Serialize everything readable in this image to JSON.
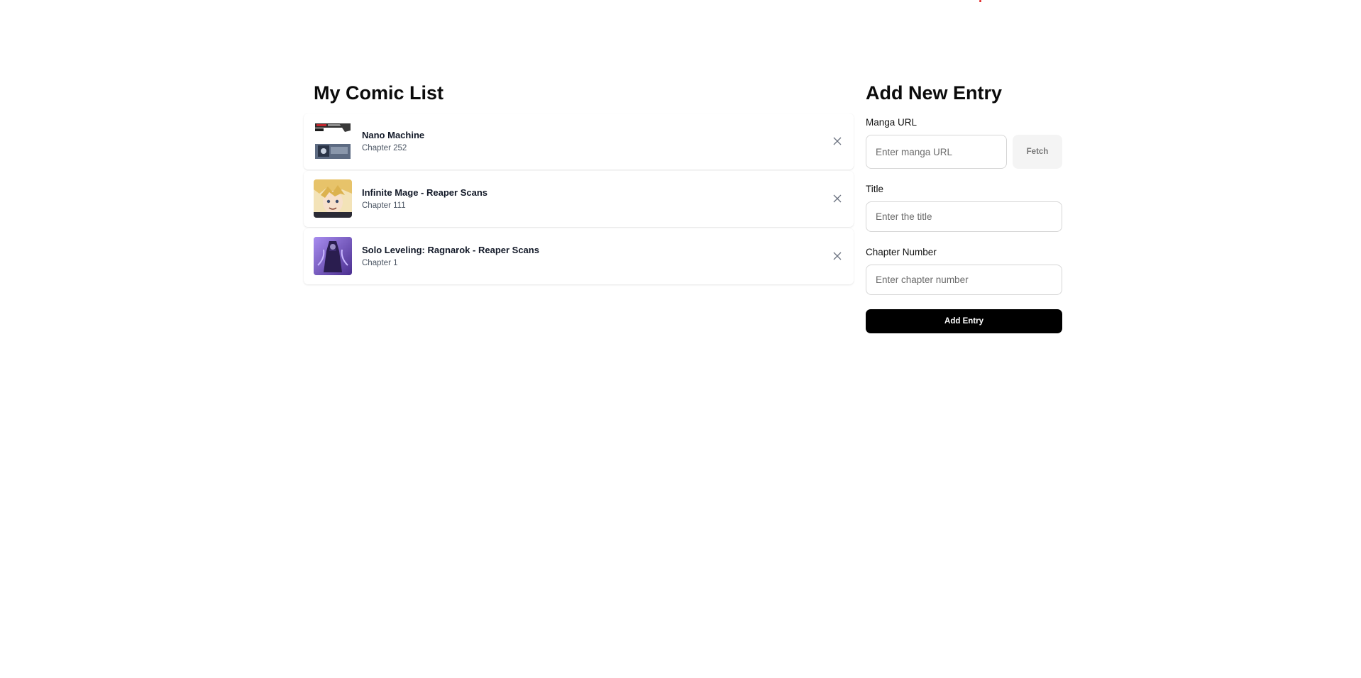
{
  "comic_list": {
    "title": "My Comic List",
    "entries": [
      {
        "title": "Nano Machine",
        "chapter": "Chapter 252",
        "thumb": "nano-machine-cover"
      },
      {
        "title": "Infinite Mage - Reaper Scans",
        "chapter": "Chapter 111",
        "thumb": "infinite-mage-cover"
      },
      {
        "title": "Solo Leveling: Ragnarok - Reaper Scans",
        "chapter": "Chapter 1",
        "thumb": "solo-leveling-ragnarok-cover"
      }
    ],
    "remove_icon": "close-icon"
  },
  "form": {
    "title": "Add New Entry",
    "url_label": "Manga URL",
    "url_placeholder": "Enter manga URL",
    "fetch_label": "Fetch",
    "title_label": "Title",
    "title_placeholder": "Enter the title",
    "chapter_label": "Chapter Number",
    "chapter_placeholder": "Enter chapter number",
    "submit_label": "Add Entry"
  },
  "colors": {
    "primary_button": "#000000",
    "fetch_button_bg": "#f4f4f4",
    "accent_dot": "#e01e1e"
  }
}
